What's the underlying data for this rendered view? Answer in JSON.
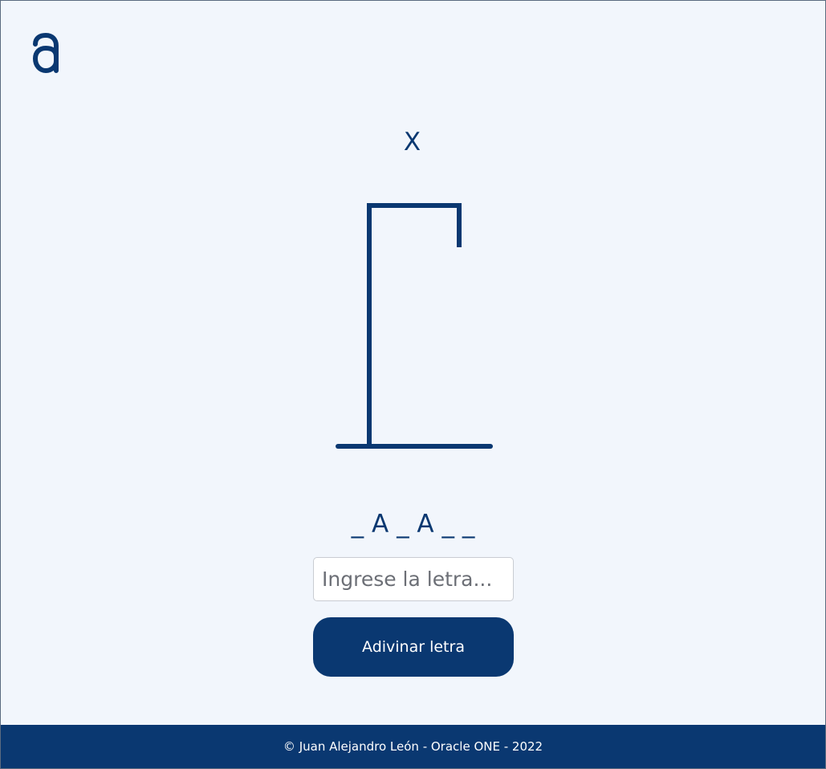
{
  "brand": {
    "logo_icon": "alura-a-logo-icon",
    "accent_color": "#0a3871"
  },
  "game": {
    "wrong_letters": "X",
    "word_display": "_ A _ A _ _",
    "hangman_icon": "gallows-icon"
  },
  "form": {
    "input_value": "",
    "input_placeholder": "Ingrese la letra...",
    "guess_button_label": "Adivinar letra"
  },
  "footer": {
    "text": "© Juan Alejandro León - Oracle ONE - 2022"
  }
}
